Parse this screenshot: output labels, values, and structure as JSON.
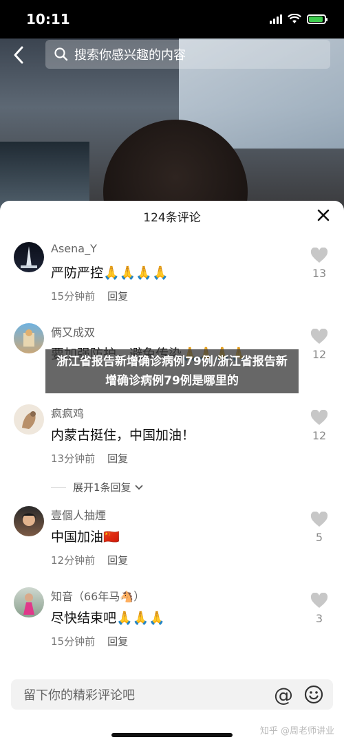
{
  "status": {
    "time": "10:11"
  },
  "header": {
    "search_placeholder": "搜索你感兴趣的内容"
  },
  "sheet": {
    "title": "124条评论"
  },
  "comments": [
    {
      "user": "Asena_Y",
      "text": "严防严控🙏🙏🙏🙏",
      "time": "15分钟前",
      "reply": "回复",
      "likes": "13"
    },
    {
      "user": "俩又成双",
      "text": "要加强防护，避免传染🙏🙏🙏🙏",
      "time": "",
      "reply": "",
      "likes": "12"
    },
    {
      "user": "疯疯鸡",
      "text": "内蒙古挺住，中国加油！",
      "time": "13分钟前",
      "reply": "回复",
      "likes": "12"
    },
    {
      "user": "壹個人抽煙",
      "text": "中国加油🇨🇳",
      "time": "12分钟前",
      "reply": "回复",
      "likes": "5"
    },
    {
      "user": "知音（66年马🐴）",
      "text": "尽快结束吧🙏🙏🙏",
      "time": "15分钟前",
      "reply": "回复",
      "likes": "3"
    }
  ],
  "expand_replies": "展开1条回复",
  "overlay": "浙江省报告新增确诊病例79例/浙江省报告新增确诊病例79例是哪里的",
  "input": {
    "placeholder": "留下你的精彩评论吧"
  },
  "watermark": "知乎 @周老师讲业"
}
